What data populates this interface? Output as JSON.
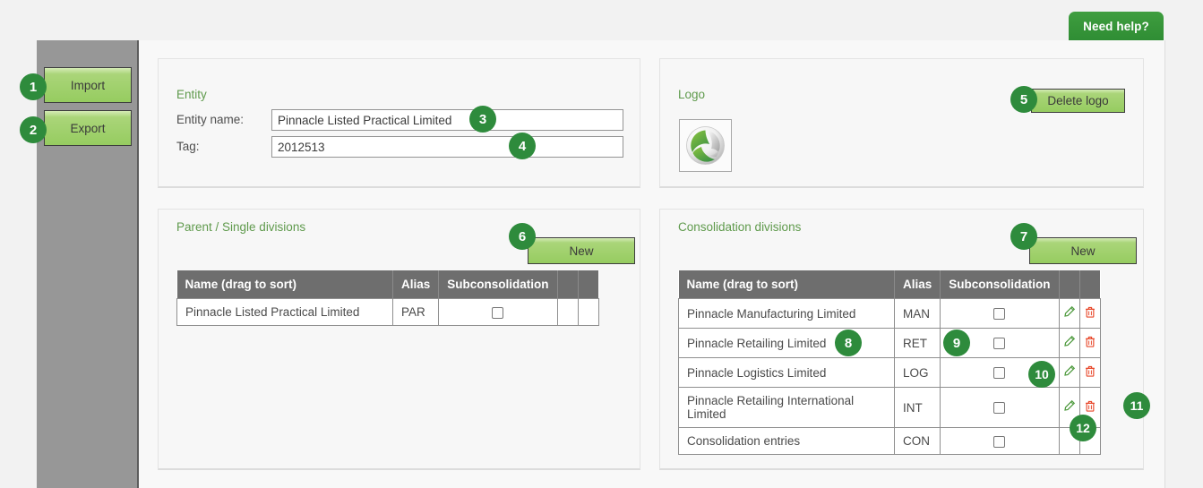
{
  "help": {
    "label": "Need help?"
  },
  "sidebar": {
    "buttons": [
      {
        "label": "Import",
        "badge": "1"
      },
      {
        "label": "Export",
        "badge": "2"
      }
    ]
  },
  "entity_panel": {
    "title": "Entity",
    "name_label": "Entity name:",
    "name_value": "Pinnacle Listed Practical Limited",
    "name_badge": "3",
    "tag_label": "Tag:",
    "tag_value": "2012513",
    "tag_badge": "4"
  },
  "logo_panel": {
    "title": "Logo",
    "delete_label": "Delete logo",
    "delete_badge": "5",
    "logo_icon": "company-swirl-logo"
  },
  "parent_panel": {
    "title": "Parent / Single divisions",
    "new_label": "New",
    "new_badge": "6",
    "columns": [
      "Name (drag to sort)",
      "Alias",
      "Subconsolidation",
      "",
      ""
    ],
    "rows": [
      {
        "name": "Pinnacle Listed Practical Limited",
        "alias": "PAR",
        "subconsolidation": false,
        "edit": false,
        "delete": false
      }
    ]
  },
  "consolidation_panel": {
    "title": "Consolidation divisions",
    "new_label": "New",
    "new_badge": "7",
    "columns": [
      "Name (drag to sort)",
      "Alias",
      "Subconsolidation",
      "",
      ""
    ],
    "rows": [
      {
        "name": "Pinnacle Manufacturing Limited",
        "alias": "MAN",
        "subconsolidation": false,
        "edit": true,
        "delete": true
      },
      {
        "name": "Pinnacle Retailing Limited",
        "alias": "RET",
        "subconsolidation": false,
        "edit": true,
        "delete": true
      },
      {
        "name": "Pinnacle Logistics Limited",
        "alias": "LOG",
        "subconsolidation": false,
        "edit": true,
        "delete": true
      },
      {
        "name": "Pinnacle Retailing International Limited",
        "alias": "INT",
        "subconsolidation": false,
        "edit": true,
        "delete": true
      },
      {
        "name": "Consolidation entries",
        "alias": "CON",
        "subconsolidation": false,
        "edit": false,
        "delete": false
      }
    ],
    "badges": {
      "row2_name": "8",
      "row2_alias": "9",
      "row3_sub": "10",
      "row4_delete": "11",
      "row5_edit": "12"
    }
  },
  "colors": {
    "accent_green": "#2e8b3c",
    "heading_green": "#5f9a4c",
    "button_green": "#96cc60",
    "table_header_gray": "#6e6e6e",
    "sidebar_gray": "#979797",
    "delete_red": "#e8482b"
  }
}
